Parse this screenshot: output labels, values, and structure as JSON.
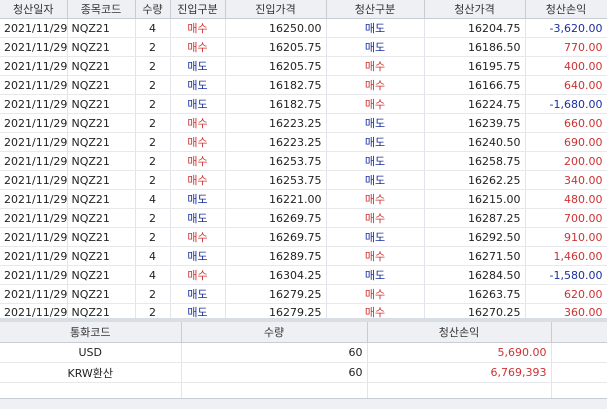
{
  "trades": {
    "columns": [
      "청산일자",
      "종목코드",
      "수량",
      "진입구분",
      "진입가격",
      "청산구분",
      "청산가격",
      "청산손익"
    ],
    "rows": [
      {
        "date": "2021/11/29",
        "code": "NQZ21",
        "qty": "4",
        "entry_side": "매수",
        "entry_price": "16250.00",
        "exit_side": "매도",
        "exit_price": "16204.75",
        "pnl": "-3,620.00"
      },
      {
        "date": "2021/11/29",
        "code": "NQZ21",
        "qty": "2",
        "entry_side": "매수",
        "entry_price": "16205.75",
        "exit_side": "매도",
        "exit_price": "16186.50",
        "pnl": "770.00"
      },
      {
        "date": "2021/11/29",
        "code": "NQZ21",
        "qty": "2",
        "entry_side": "매도",
        "entry_price": "16205.75",
        "exit_side": "매수",
        "exit_price": "16195.75",
        "pnl": "400.00"
      },
      {
        "date": "2021/11/29",
        "code": "NQZ21",
        "qty": "2",
        "entry_side": "매도",
        "entry_price": "16182.75",
        "exit_side": "매수",
        "exit_price": "16166.75",
        "pnl": "640.00"
      },
      {
        "date": "2021/11/29",
        "code": "NQZ21",
        "qty": "2",
        "entry_side": "매도",
        "entry_price": "16182.75",
        "exit_side": "매수",
        "exit_price": "16224.75",
        "pnl": "-1,680.00"
      },
      {
        "date": "2021/11/29",
        "code": "NQZ21",
        "qty": "2",
        "entry_side": "매수",
        "entry_price": "16223.25",
        "exit_side": "매도",
        "exit_price": "16239.75",
        "pnl": "660.00"
      },
      {
        "date": "2021/11/29",
        "code": "NQZ21",
        "qty": "2",
        "entry_side": "매수",
        "entry_price": "16223.25",
        "exit_side": "매도",
        "exit_price": "16240.50",
        "pnl": "690.00"
      },
      {
        "date": "2021/11/29",
        "code": "NQZ21",
        "qty": "2",
        "entry_side": "매수",
        "entry_price": "16253.75",
        "exit_side": "매도",
        "exit_price": "16258.75",
        "pnl": "200.00"
      },
      {
        "date": "2021/11/29",
        "code": "NQZ21",
        "qty": "2",
        "entry_side": "매수",
        "entry_price": "16253.75",
        "exit_side": "매도",
        "exit_price": "16262.25",
        "pnl": "340.00"
      },
      {
        "date": "2021/11/29",
        "code": "NQZ21",
        "qty": "4",
        "entry_side": "매도",
        "entry_price": "16221.00",
        "exit_side": "매수",
        "exit_price": "16215.00",
        "pnl": "480.00"
      },
      {
        "date": "2021/11/29",
        "code": "NQZ21",
        "qty": "2",
        "entry_side": "매도",
        "entry_price": "16269.75",
        "exit_side": "매수",
        "exit_price": "16287.25",
        "pnl": "700.00"
      },
      {
        "date": "2021/11/29",
        "code": "NQZ21",
        "qty": "2",
        "entry_side": "매수",
        "entry_price": "16269.75",
        "exit_side": "매도",
        "exit_price": "16292.50",
        "pnl": "910.00"
      },
      {
        "date": "2021/11/29",
        "code": "NQZ21",
        "qty": "4",
        "entry_side": "매도",
        "entry_price": "16289.75",
        "exit_side": "매수",
        "exit_price": "16271.50",
        "pnl": "1,460.00"
      },
      {
        "date": "2021/11/29",
        "code": "NQZ21",
        "qty": "4",
        "entry_side": "매수",
        "entry_price": "16304.25",
        "exit_side": "매도",
        "exit_price": "16284.50",
        "pnl": "-1,580.00"
      },
      {
        "date": "2021/11/29",
        "code": "NQZ21",
        "qty": "2",
        "entry_side": "매도",
        "entry_price": "16279.25",
        "exit_side": "매수",
        "exit_price": "16263.75",
        "pnl": "620.00"
      },
      {
        "date": "2021/11/29",
        "code": "NQZ21",
        "qty": "2",
        "entry_side": "매도",
        "entry_price": "16279.25",
        "exit_side": "매수",
        "exit_price": "16270.25",
        "pnl": "360.00"
      }
    ]
  },
  "summary": {
    "columns": [
      "통화코드",
      "수량",
      "청산손익"
    ],
    "rows": [
      {
        "currency": "USD",
        "qty": "60",
        "pnl": "5,690.00"
      },
      {
        "currency": "KRW환산",
        "qty": "60",
        "pnl": "6,769,393"
      },
      {
        "currency": "",
        "qty": "",
        "pnl": ""
      }
    ]
  },
  "colors": {
    "buy": "#cc3333",
    "sell": "#1a2fa0",
    "positive": "#cc3333",
    "negative": "#1a2fa0"
  }
}
